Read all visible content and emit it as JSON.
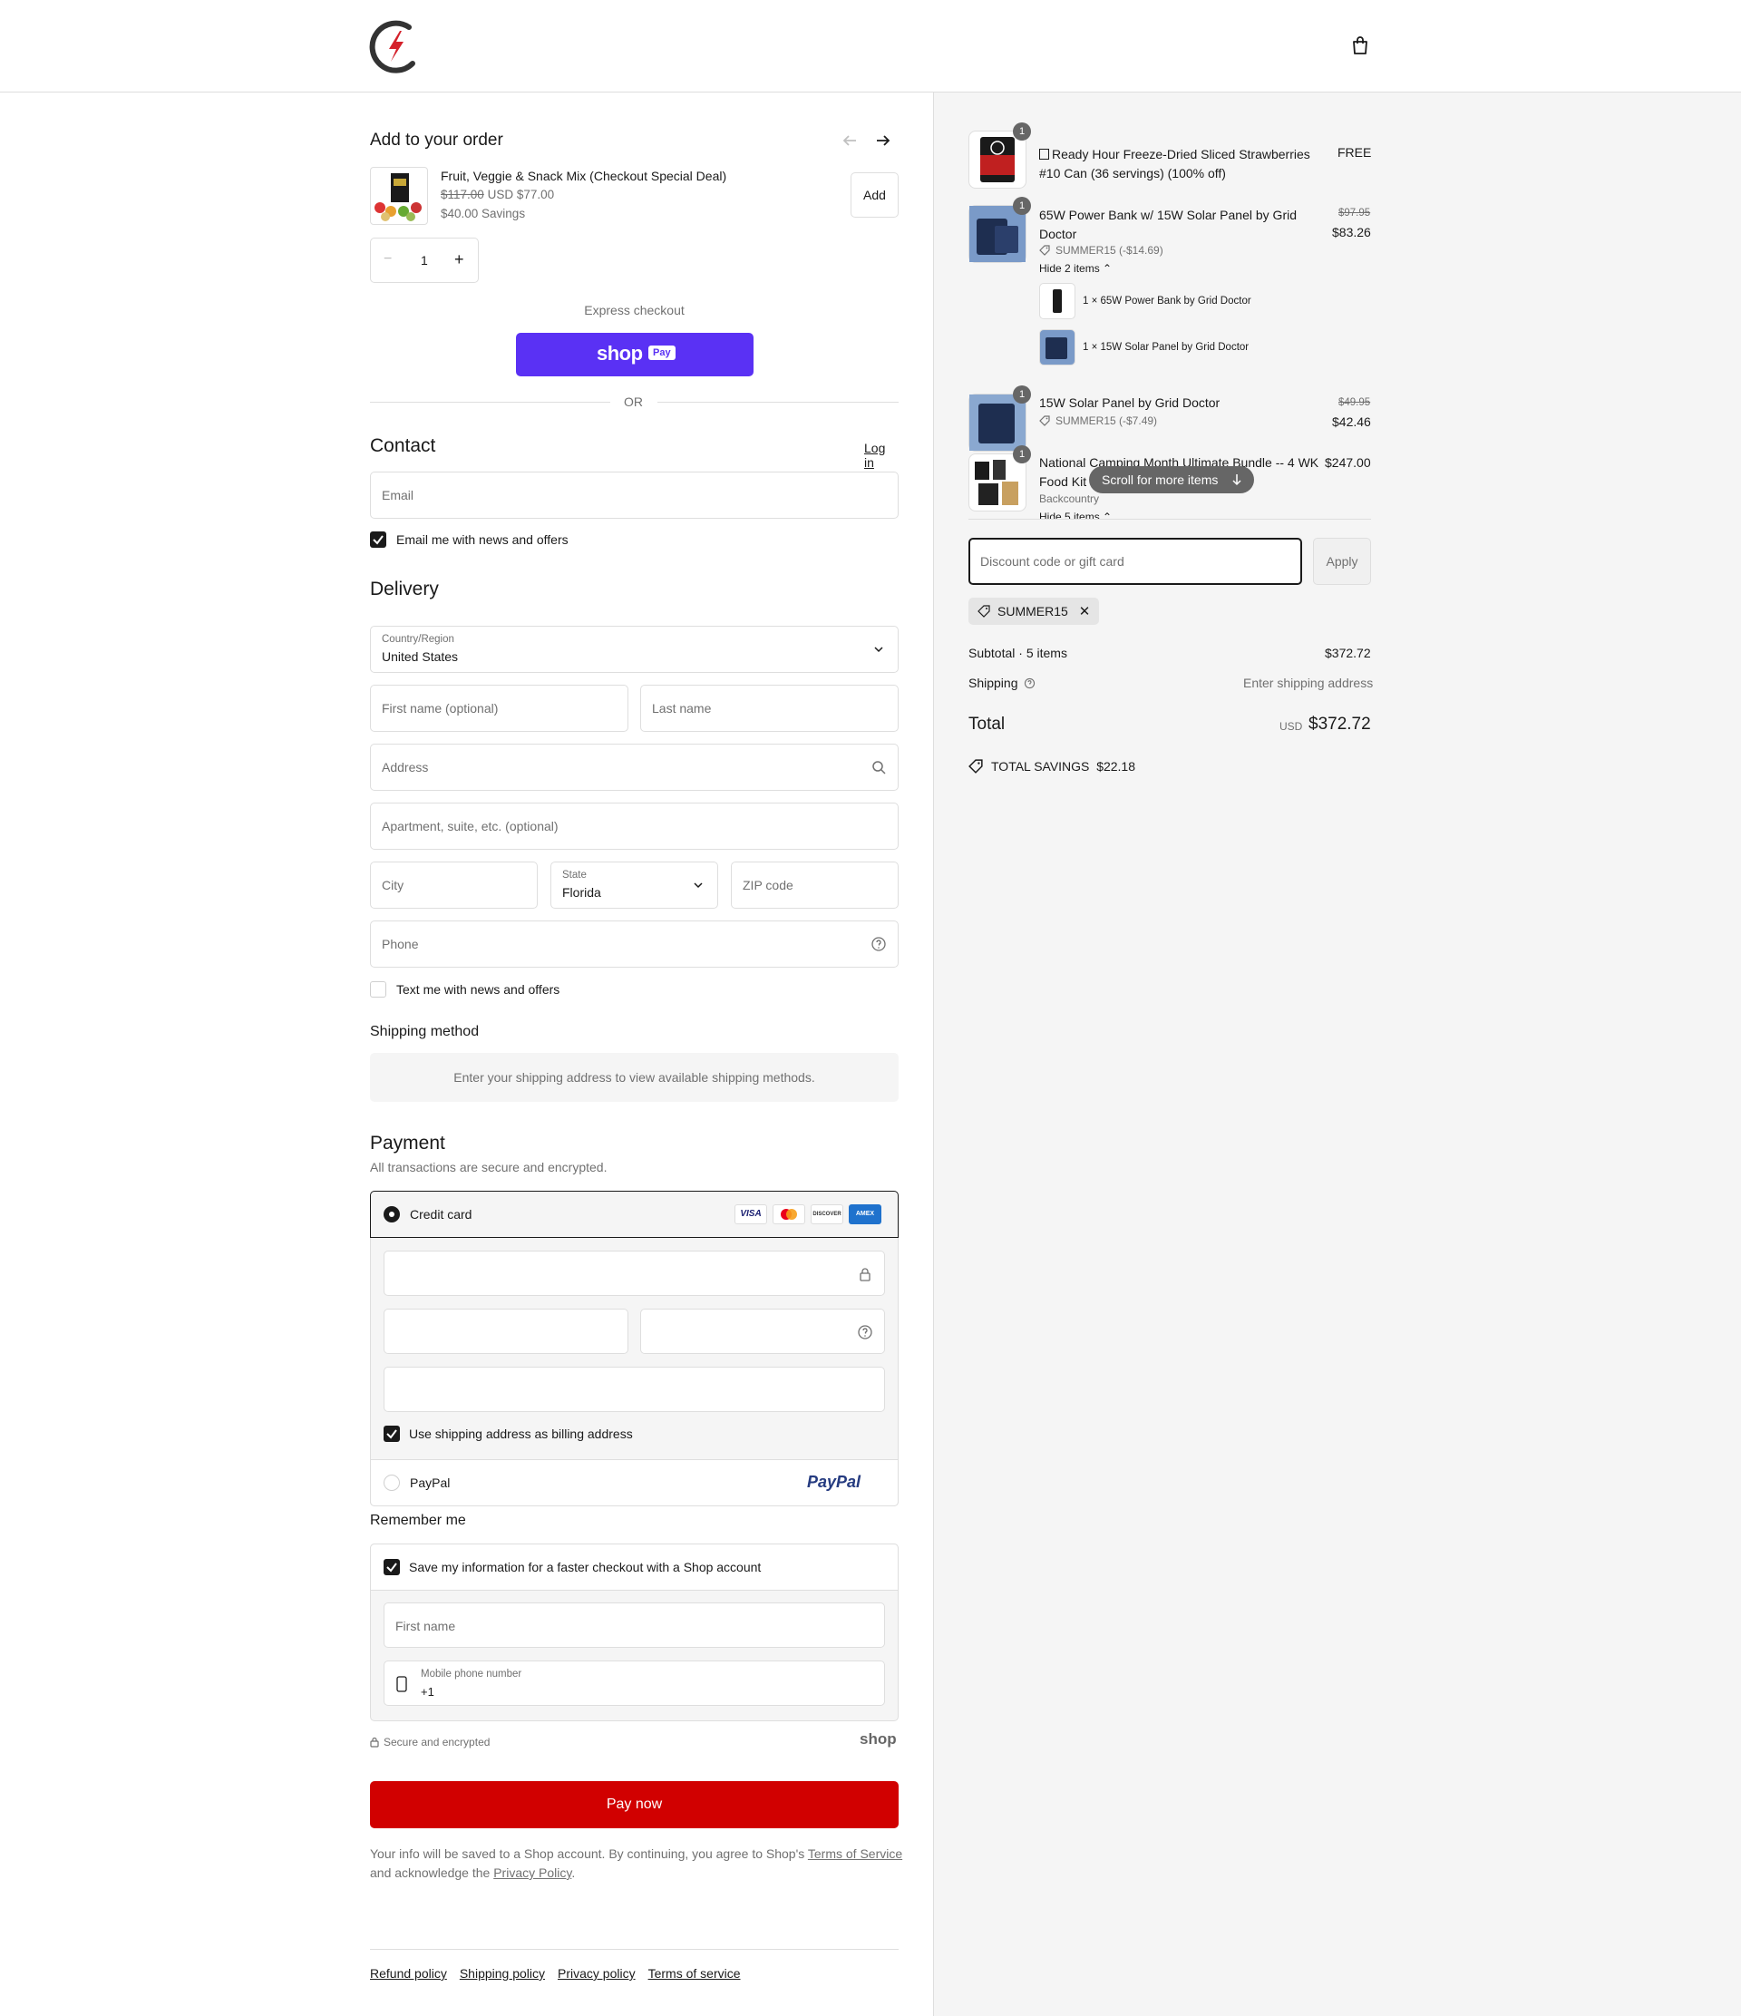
{
  "header": {
    "logo_alt": "store logo",
    "cart_icon": "shopping-bag-icon"
  },
  "upsell": {
    "title": "Add to your order",
    "product_name": "Fruit, Veggie & Snack Mix (Checkout Special Deal)",
    "old_price": "$117.00",
    "new_price": "USD $77.00",
    "savings": "$40.00 Savings",
    "add_label": "Add",
    "quantity": "1"
  },
  "express": {
    "title": "Express checkout",
    "shop_pay_label": "shop",
    "shop_pay_badge": "Pay",
    "or_label": "OR"
  },
  "contact": {
    "title": "Contact",
    "login_label": "Log in",
    "email_placeholder": "Email",
    "newsletter_label": "Email me with news and offers"
  },
  "delivery": {
    "title": "Delivery",
    "country_label": "Country/Region",
    "country_value": "United States",
    "first_name_placeholder": "First name (optional)",
    "last_name_placeholder": "Last name",
    "address_placeholder": "Address",
    "apartment_placeholder": "Apartment, suite, etc. (optional)",
    "city_placeholder": "City",
    "state_label": "State",
    "state_value": "Florida",
    "zip_placeholder": "ZIP code",
    "phone_placeholder": "Phone",
    "sms_label": "Text me with news and offers"
  },
  "shipping_method": {
    "title": "Shipping method",
    "notice": "Enter your shipping address to view available shipping methods."
  },
  "payment": {
    "title": "Payment",
    "subtitle": "All transactions are secure and encrypted.",
    "credit_card_label": "Credit card",
    "card_brands": [
      "VISA",
      "DISCOVER",
      "AMEX"
    ],
    "billing_label": "Use shipping address as billing address",
    "paypal_label": "PayPal",
    "paypal_logo": "PayPal"
  },
  "remember": {
    "title": "Remember me",
    "save_label": "Save my information for a faster checkout with a Shop account",
    "first_name_placeholder": "First name",
    "phone_label": "Mobile phone number",
    "phone_value": "+1",
    "secure_label": "Secure and encrypted",
    "shop_logo": "shop"
  },
  "pay_now": {
    "label": "Pay now",
    "legal_prefix": "Your info will be saved to a Shop account. By continuing, you agree to Shop's ",
    "terms_link": "Terms of Service",
    "legal_mid": "and acknowledge the ",
    "privacy_link": "Privacy Policy",
    "legal_end": ".",
    "accent": "#d10000"
  },
  "footer": {
    "links": [
      "Refund policy",
      "Shipping policy",
      "Privacy policy",
      "Terms of service"
    ]
  },
  "summary": {
    "items": [
      {
        "qty": "1",
        "name_line1": "Ready Hour Freeze-Dried Sliced Strawberries",
        "name_line2": "#10 Can (36 servings) (100% off)",
        "price": "FREE"
      },
      {
        "qty": "1",
        "name_line1": "65W Power Bank w/ 15W Solar Panel by Grid",
        "name_line2": "Doctor",
        "old_price": "$97.95",
        "price": "$83.26",
        "discount": "SUMMER15 (-$14.69)",
        "toggle": "Hide 2 items",
        "components": [
          "1 × 65W Power Bank by Grid Doctor",
          "1 × 15W Solar Panel by Grid Doctor"
        ]
      },
      {
        "qty": "1",
        "name_line1": "15W Solar Panel by Grid Doctor",
        "old_price": "$49.95",
        "price": "$42.46",
        "discount": "SUMMER15 (-$7.49)"
      },
      {
        "qty": "1",
        "name_line1": "National Camping Month Ultimate Bundle -- 4 WK",
        "name_line2": "Food Kit",
        "vendor": "Backcountry",
        "price": "$247.00",
        "toggle": "Hide 5 items"
      }
    ],
    "scroll_hint": "Scroll for more items",
    "discount_placeholder": "Discount code or gift card",
    "apply_label": "Apply",
    "applied_code": "SUMMER15",
    "subtotal_label": "Subtotal · 5 items",
    "subtotal_value": "$372.72",
    "shipping_label": "Shipping",
    "shipping_value": "Enter shipping address",
    "total_label": "Total",
    "total_currency": "USD",
    "total_value": "$372.72",
    "savings_label": "TOTAL SAVINGS",
    "savings_value": "$22.18"
  }
}
